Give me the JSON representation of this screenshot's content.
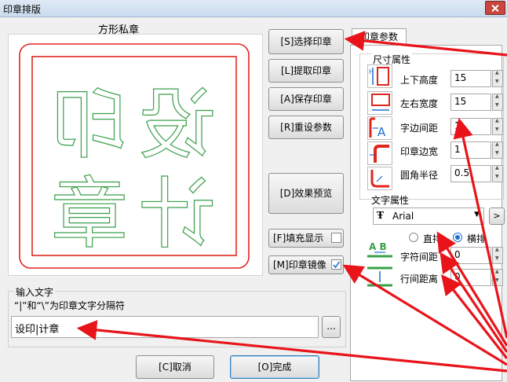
{
  "window": {
    "title": "印章排版"
  },
  "preview": {
    "title": "方形私章",
    "seal_chars": [
      "设",
      "计",
      "印",
      "章"
    ]
  },
  "buttons": {
    "select": "[S]选择印章",
    "extract": "[L]提取印章",
    "save": "[A]保存印章",
    "reset": "[R]重设参数",
    "preview": "[D]效果预览",
    "cancel": "[C]取消",
    "done": "[O]完成"
  },
  "options": {
    "fill_label": "[F]填充显示",
    "fill_checked": false,
    "mirror_label": "[M]印章镜像",
    "mirror_checked": true
  },
  "params": {
    "tab_label": "印章参数",
    "size_group": "尺寸属性",
    "height_label": "上下高度",
    "height_value": "15",
    "width_label": "左右宽度",
    "width_value": "15",
    "spacing_label": "字边间距",
    "spacing_value": "1",
    "border_label": "印章边宽",
    "border_value": "1",
    "radius_label": "圆角半径",
    "radius_value": "0.5",
    "text_group": "文字属性",
    "font_value": "Arial",
    "vertical_label": "直排",
    "horizontal_label": "横排",
    "orientation_selected": "横排",
    "char_spacing_label": "字符间距",
    "char_spacing_value": "0",
    "line_spacing_label": "行间距离",
    "line_spacing_value": "0"
  },
  "input": {
    "group_label": "输入文字",
    "hint": "“|”和“\\”为印章文字分隔符",
    "value": "设印|计章",
    "browse_label": "..."
  },
  "colors": {
    "seal_red": "#e0271f",
    "glyph_green": "#3aa04a",
    "annotation_red": "#e8141a",
    "accent_blue": "#1f6fd0"
  }
}
